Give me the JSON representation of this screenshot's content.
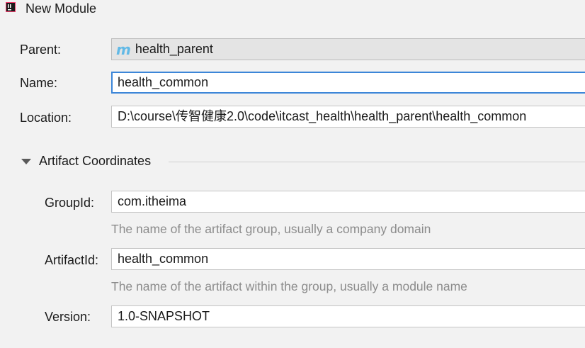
{
  "window": {
    "title": "New Module"
  },
  "form": {
    "parent_label": "Parent:",
    "parent_value": "health_parent",
    "parent_icon": "m",
    "name_label": "Name:",
    "name_value": "health_common",
    "location_label": "Location:",
    "location_value": "D:\\course\\传智健康2.0\\code\\itcast_health\\health_parent\\health_common"
  },
  "artifact": {
    "section_title": "Artifact Coordinates",
    "expanded": true,
    "group_label": "GroupId:",
    "group_value": "com.itheima",
    "group_hint": "The name of the artifact group, usually a company domain",
    "artifact_label": "ArtifactId:",
    "artifact_value": "health_common",
    "artifact_hint": "The name of the artifact within the group, usually a module name",
    "version_label": "Version:",
    "version_value": "1.0-SNAPSHOT"
  },
  "colors": {
    "background": "#f2f2f2",
    "focus_border": "#3c86d8",
    "maven_icon": "#61b9e6",
    "hint_text": "#8c8c8c"
  }
}
